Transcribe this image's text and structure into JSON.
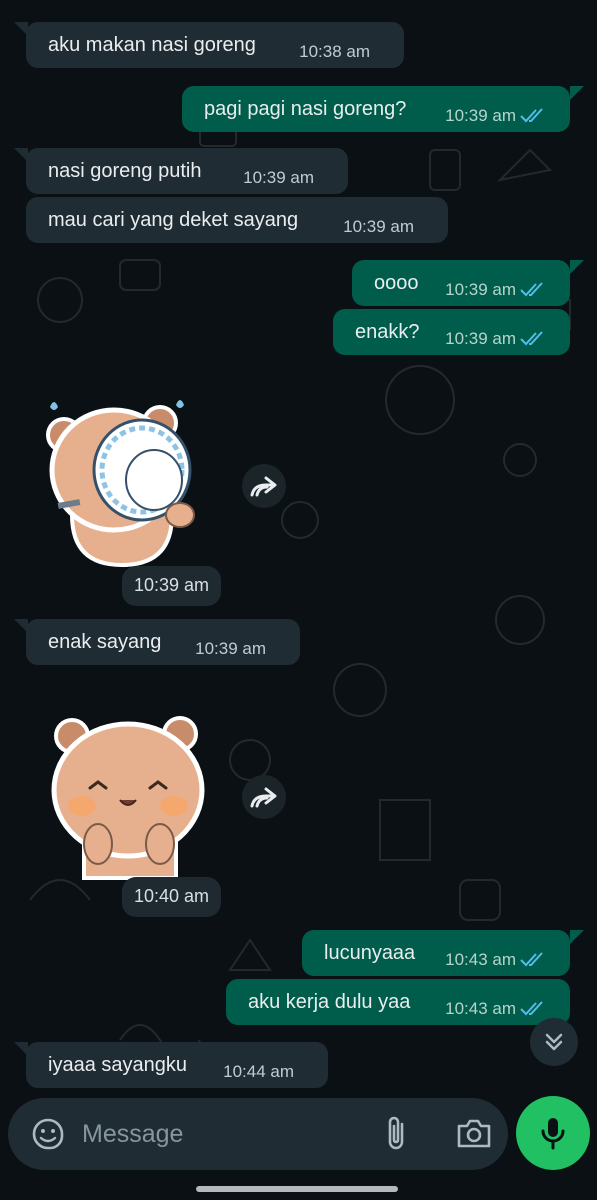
{
  "messages": [
    {
      "dir": "in",
      "text": "aku makan nasi goreng",
      "time": "10:38 am"
    },
    {
      "dir": "out",
      "text": "pagi pagi nasi goreng?",
      "time": "10:39 am",
      "read": true
    },
    {
      "dir": "in",
      "text": "nasi goreng putih",
      "time": "10:39 am"
    },
    {
      "dir": "in",
      "text": "mau cari yang deket sayang",
      "time": "10:39 am"
    },
    {
      "dir": "out",
      "text": "oooo",
      "time": "10:39 am",
      "read": true
    },
    {
      "dir": "out",
      "text": "enakk?",
      "time": "10:39 am",
      "read": true
    },
    {
      "dir": "in",
      "type": "sticker",
      "sticker": "bear-drinking-from-bowl",
      "time": "10:39 am"
    },
    {
      "dir": "in",
      "text": "enak sayang",
      "time": "10:39 am"
    },
    {
      "dir": "in",
      "type": "sticker",
      "sticker": "bear-blushing-happy",
      "time": "10:40 am"
    },
    {
      "dir": "out",
      "text": "lucunyaaa",
      "time": "10:43 am",
      "read": true
    },
    {
      "dir": "out",
      "text": "aku kerja dulu yaa",
      "time": "10:43 am",
      "read": true
    },
    {
      "dir": "in",
      "text": "iyaaa sayangku",
      "time": "10:44 am"
    }
  ],
  "composer": {
    "placeholder": "Message"
  },
  "icons": {
    "emoji": "sticker-icon",
    "attach": "paperclip-icon",
    "camera": "camera-icon",
    "mic": "microphone-icon",
    "forward": "forward-icon",
    "scroll": "double-chevron-down-icon",
    "read_receipt": "double-check-icon"
  },
  "colors": {
    "background": "#0b1014",
    "incoming_bubble": "#202c33",
    "outgoing_bubble": "#005c4b",
    "read_tick": "#53bdeb",
    "mic_button": "#21c063"
  }
}
